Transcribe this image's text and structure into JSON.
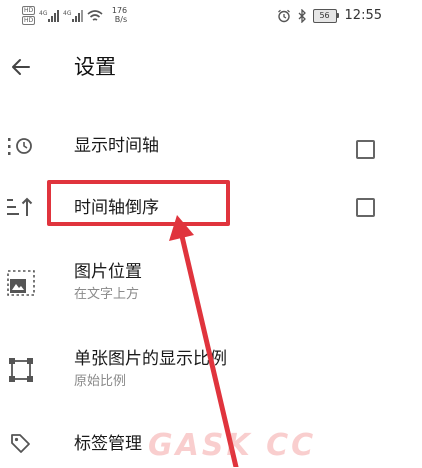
{
  "status_bar": {
    "hd_badges": [
      "HD",
      "HD"
    ],
    "network_labels": [
      "4G",
      "4G"
    ],
    "speed_value": "176",
    "speed_unit": "B/s",
    "battery": "56",
    "time": "12:55"
  },
  "header": {
    "title": "设置",
    "back_icon": "arrow-left-icon"
  },
  "items": [
    {
      "icon": "timeline-clock-icon",
      "title": "显示时间轴",
      "checkbox": false
    },
    {
      "icon": "sort-reverse-icon",
      "title": "时间轴倒序",
      "checkbox": false
    },
    {
      "icon": "image-position-icon",
      "title": "图片位置",
      "subtitle": "在文字上方"
    },
    {
      "icon": "crop-ratio-icon",
      "title": "单张图片的显示比例",
      "subtitle": "原始比例"
    },
    {
      "icon": "tag-icon",
      "title": "标签管理"
    }
  ],
  "annotation": {
    "highlight_color": "#e0343d",
    "arrow_color": "#e0343d"
  },
  "watermark": "GASK CC"
}
